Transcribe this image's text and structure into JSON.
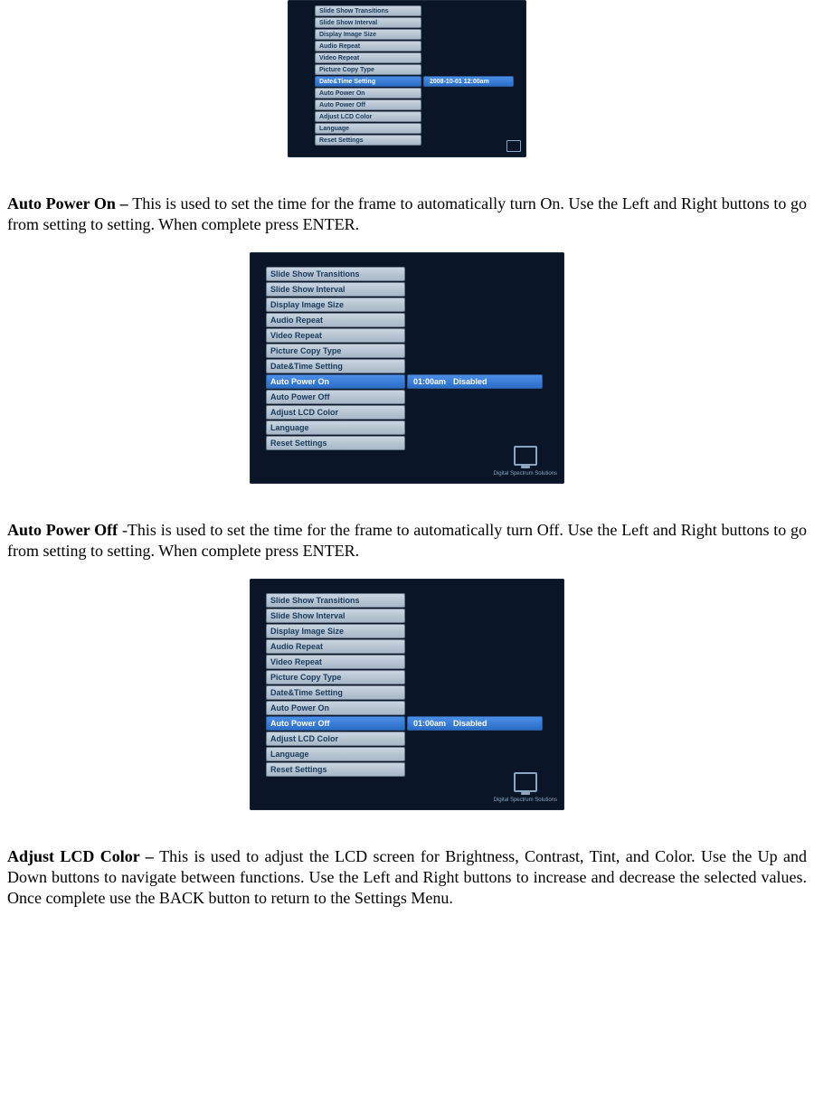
{
  "screenshot1": {
    "menu_items": [
      "Slide Show Transitions",
      "Slide Show Interval",
      "Display Image Size",
      "Audio Repeat",
      "Video Repeat",
      "Picture Copy Type",
      "Date&Time Setting",
      "Auto Power On",
      "Auto Power Off",
      "Adjust LCD Color",
      "Language",
      "Reset Settings"
    ],
    "selected_index": 6,
    "selected_value": "2008-10-01 12:00am"
  },
  "section_auto_power_on": {
    "title": "Auto Power On – ",
    "body": "This is used to set the time for the frame to automatically turn On. Use the Left and Right buttons to go from setting to setting. When complete press ENTER."
  },
  "screenshot2": {
    "menu_items": [
      "Slide Show Transitions",
      "Slide Show Interval",
      "Display Image Size",
      "Audio Repeat",
      "Video Repeat",
      "Picture Copy Type",
      "Date&Time Setting",
      "Auto Power On",
      "Auto Power Off",
      "Adjust LCD Color",
      "Language",
      "Reset Settings"
    ],
    "selected_index": 7,
    "selected_value_a": "01:00am",
    "selected_value_b": "Disabled",
    "logo_text": "Digital Spectrum Solutions"
  },
  "section_auto_power_off": {
    "title": "Auto Power Off ",
    "body": "-This is used to set the time for the frame to automatically turn Off. Use the Left and Right buttons to go from setting to setting. When complete press ENTER."
  },
  "screenshot3": {
    "menu_items": [
      "Slide Show Transitions",
      "Slide Show Interval",
      "Display Image Size",
      "Audio Repeat",
      "Video Repeat",
      "Picture Copy Type",
      "Date&Time Setting",
      "Auto Power On",
      "Auto Power Off",
      "Adjust LCD Color",
      "Language",
      "Reset Settings"
    ],
    "selected_index": 8,
    "selected_value_a": "01:00am",
    "selected_value_b": "Disabled",
    "logo_text": "Digital Spectrum Solutions"
  },
  "section_adjust_lcd": {
    "title": "Adjust LCD Color – ",
    "body": "This is used to adjust the LCD screen for Brightness, Contrast, Tint, and Color. Use the Up and Down buttons to navigate between functions. Use the Left and Right buttons to increase and decrease the selected values. Once complete use the BACK button to return to the Settings Menu."
  }
}
